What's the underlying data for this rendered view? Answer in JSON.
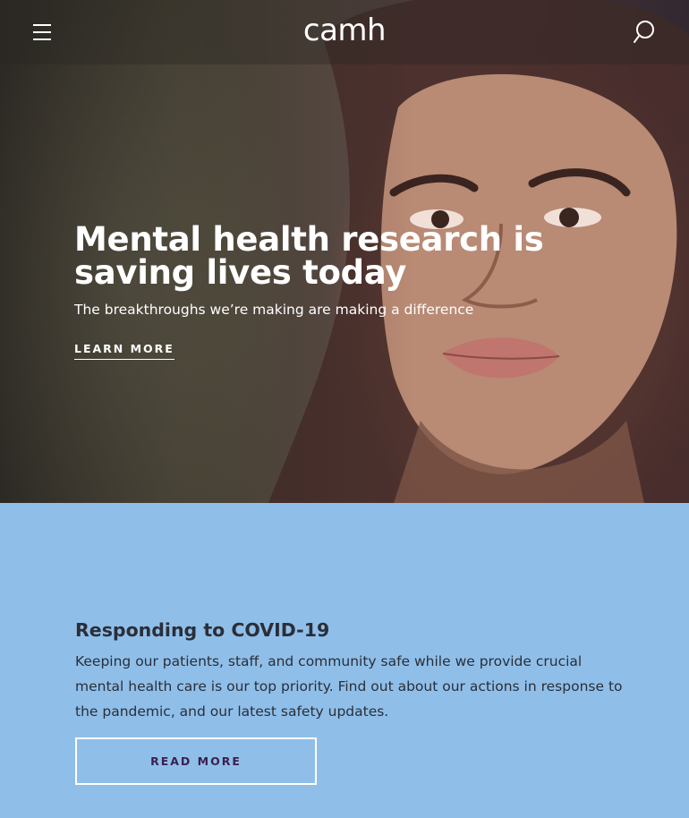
{
  "header": {
    "logo_text": "camh",
    "menu_icon": "hamburger-menu-icon",
    "search_icon": "search-icon"
  },
  "hero": {
    "title": "Mental health research is saving lives today",
    "subtitle": "The breakthroughs we’re making are making a difference",
    "cta_label": "LEARN MORE"
  },
  "covid": {
    "title": "Responding to COVID-19",
    "body": "Keeping our patients, staff, and community safe while we provide crucial mental health care is our top priority. Find out about our actions in response to the pandemic, and our latest safety updates.",
    "button_label": "READ MORE"
  },
  "colors": {
    "section_background": "#8fbfe9",
    "heading_text": "#2b2e38",
    "button_text": "#3b1f4f",
    "hero_text": "#ffffff"
  }
}
